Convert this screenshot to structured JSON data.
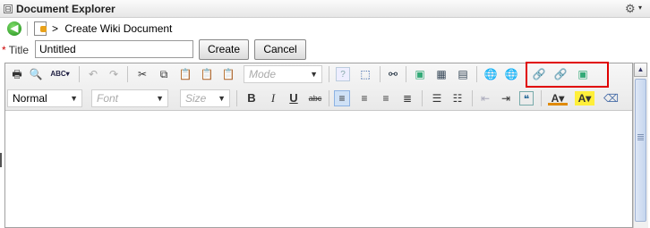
{
  "panel": {
    "title": "Document Explorer",
    "collapse_symbol": "⊟",
    "gear_symbol": "⚙",
    "gear_dropdown": "▾"
  },
  "breadcrumb": {
    "separator": ">",
    "current": "Create Wiki Document",
    "back_symbol": "◀"
  },
  "title_row": {
    "required_mark": "*",
    "label": "Title",
    "value": "Untitled",
    "create_label": "Create",
    "cancel_label": "Cancel"
  },
  "toolbar": {
    "mode_combo": {
      "value": "Mode",
      "arrow": "▼"
    },
    "format_combo": {
      "value": "Normal",
      "arrow": "▼"
    },
    "font_combo": {
      "value": "Font",
      "arrow": "▼"
    },
    "size_combo": {
      "value": "Size",
      "arrow": "▼"
    },
    "bold": "B",
    "italic": "I",
    "underline": "U",
    "strike": "abc",
    "spellcheck_label": "ABC"
  },
  "scrollbar": {
    "up_arrow": "▲"
  },
  "colors": {
    "highlight_box": "#e00000",
    "back_button": "#1f8f1a",
    "scroll_thumb": "#c5d5ee"
  }
}
